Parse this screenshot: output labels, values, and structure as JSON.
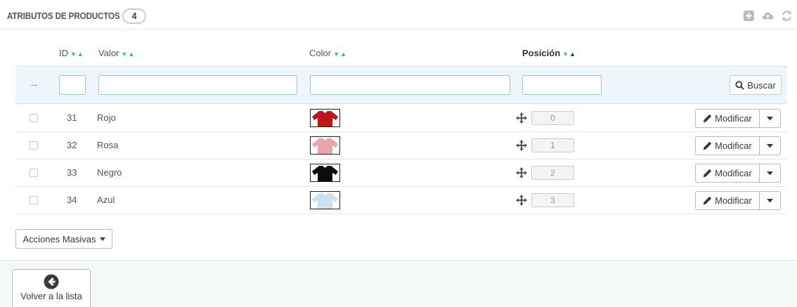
{
  "header": {
    "title": "ATRIBUTOS DE PRODUCTOS",
    "count": "4",
    "toolbar_icons": [
      "add-icon",
      "cloud-upload-icon",
      "refresh-icon"
    ]
  },
  "table": {
    "columns": {
      "id": "ID",
      "value": "Valor",
      "color": "Color",
      "position": "Posición"
    },
    "filter": {
      "dash": "--",
      "search_label": "Buscar"
    },
    "rows": [
      {
        "id": "31",
        "value": "Rojo",
        "color": "#c0161b",
        "position": "0",
        "edit_label": "Modificar"
      },
      {
        "id": "32",
        "value": "Rosa",
        "color": "#e8a6ab",
        "position": "1",
        "edit_label": "Modificar"
      },
      {
        "id": "33",
        "value": "Negro",
        "color": "#0d0d0d",
        "position": "2",
        "edit_label": "Modificar"
      },
      {
        "id": "34",
        "value": "Azul",
        "color": "#cfe0f2",
        "position": "3",
        "edit_label": "Modificar"
      }
    ]
  },
  "bulk_actions": {
    "label": "Acciones Masivas"
  },
  "footer": {
    "back_label": "Volver a la lista"
  },
  "colors": {
    "accent": "#25b9d7",
    "filter_bg": "#ecf6fb"
  }
}
